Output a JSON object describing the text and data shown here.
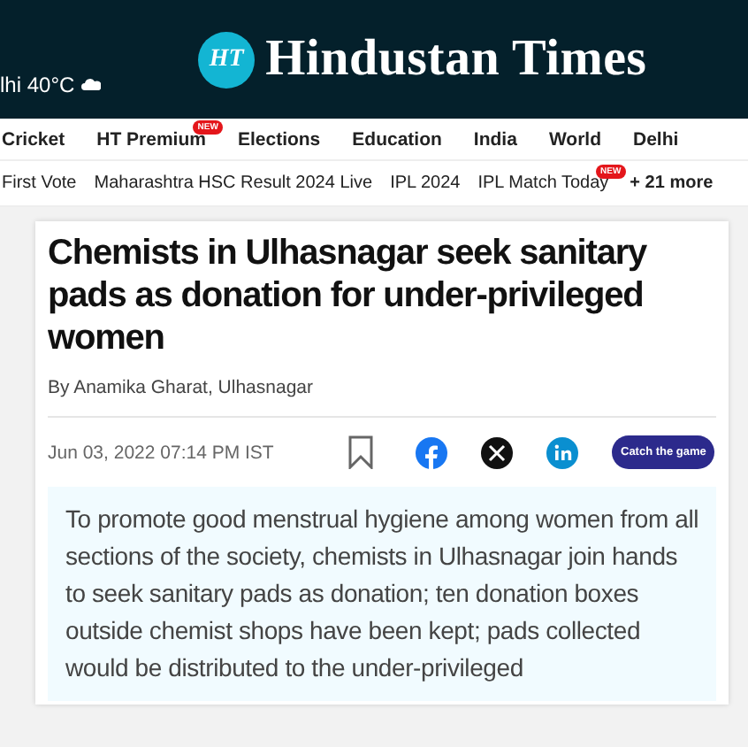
{
  "header": {
    "weather": "lhi 40°C",
    "logo_mark": "HT",
    "logo_text": "Hindustan Times"
  },
  "nav": [
    {
      "label": "Cricket"
    },
    {
      "label": "HT Premium",
      "badge": "NEW"
    },
    {
      "label": "Elections"
    },
    {
      "label": "Education"
    },
    {
      "label": "India"
    },
    {
      "label": "World"
    },
    {
      "label": "Delhi"
    }
  ],
  "trending": [
    {
      "label": "First Vote"
    },
    {
      "label": "Maharashtra HSC Result 2024 Live"
    },
    {
      "label": "IPL 2024"
    },
    {
      "label": "IPL Match Today",
      "badge": "NEW"
    }
  ],
  "trending_more": "+ 21 more",
  "article": {
    "title": "Chemists in Ulhasnagar seek sanitary pads as donation for under-privileged women",
    "byline": "By Anamika Gharat, Ulhasnagar",
    "date": "Jun 03, 2022 07:14 PM IST",
    "cta": "Catch the game",
    "summary": "To promote good menstrual hygiene among women from all sections of the society, chemists in Ulhasnagar join hands to seek sanitary pads as donation; ten donation boxes outside chemist shops have been kept; pads collected would be distributed to the under-privileged"
  }
}
